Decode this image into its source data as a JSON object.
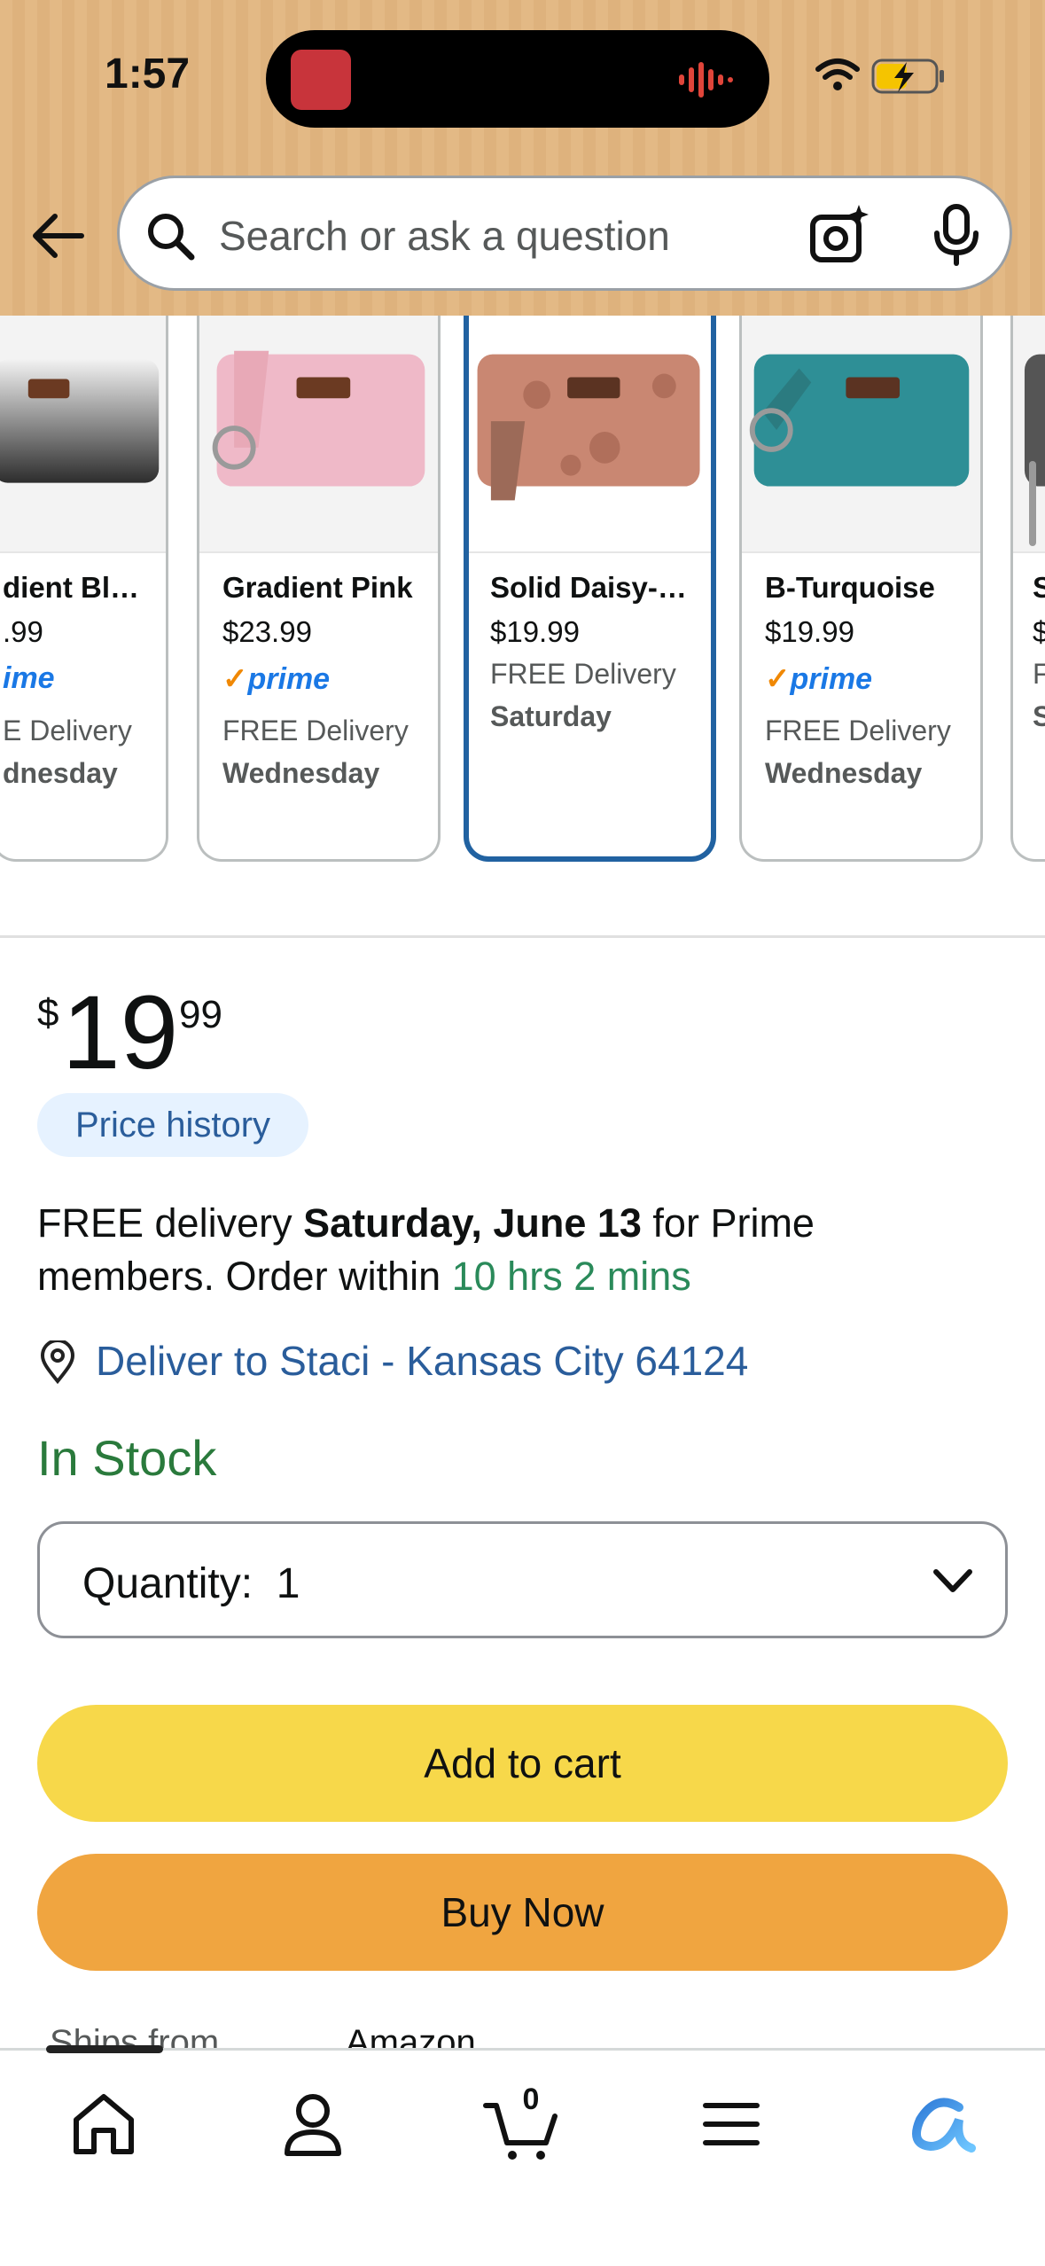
{
  "status_bar": {
    "time": "1:57"
  },
  "search": {
    "placeholder": "Search or ask a question"
  },
  "variants": [
    {
      "name": "dient Bl…",
      "price": ".99",
      "prime": "ime",
      "free": "E Delivery",
      "day": "dnesday",
      "color": "gradient-black"
    },
    {
      "name": "Gradient Pink",
      "price": "$23.99",
      "prime": "prime",
      "free": "FREE Delivery",
      "day": "Wednesday",
      "color": "pink"
    },
    {
      "name": "Solid Daisy-…",
      "price": "$19.99",
      "prime": "",
      "free": "FREE Delivery",
      "day": "Saturday",
      "color": "daisy-brown",
      "selected": true
    },
    {
      "name": "B-Turquoise",
      "price": "$19.99",
      "prime": "prime",
      "free": "FREE Delivery",
      "day": "Wednesday",
      "color": "turquoise"
    },
    {
      "name": "S",
      "price": "$",
      "prime": "",
      "free": "F",
      "day": "S",
      "color": "dark"
    }
  ],
  "price": {
    "symbol": "$",
    "whole": "19",
    "fraction": "99"
  },
  "price_history_label": "Price history",
  "delivery": {
    "prefix": "FREE delivery ",
    "date": "Saturday, June 13",
    "middle": " for Prime members. Order within ",
    "countdown": "10 hrs 2 mins"
  },
  "deliver_to": "Deliver to Staci - Kansas City 64124",
  "stock_status": "In Stock",
  "quantity": {
    "label": "Quantity:",
    "value": "1"
  },
  "buttons": {
    "add_to_cart": "Add to cart",
    "buy_now": "Buy Now"
  },
  "ships_from": {
    "label": "Ships from",
    "value": "Amazon"
  },
  "bottom_nav": {
    "cart_count": "0"
  },
  "colors": {
    "header": "#e3b985",
    "link": "#2a5d9b",
    "in_stock": "#2a7a3c",
    "add_to_cart": "#f7d84a",
    "buy_now": "#f0a540",
    "selected_border": "#2162a1"
  }
}
